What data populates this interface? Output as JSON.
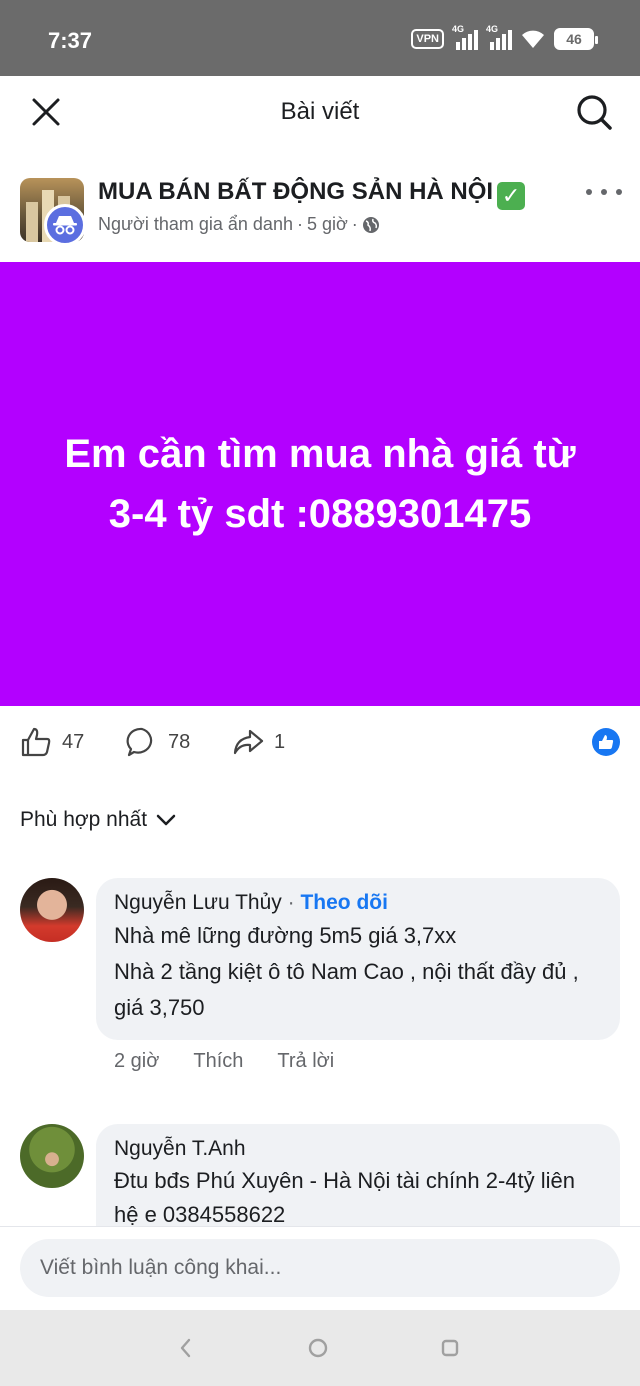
{
  "status_bar": {
    "time": "7:37",
    "vpn": "VPN",
    "network1": "4G",
    "network2": "4G",
    "battery": "46"
  },
  "header": {
    "title": "Bài viết",
    "close_icon": "close-icon",
    "search_icon": "search-icon"
  },
  "post": {
    "group_name": "MUA BÁN BẤT ĐỘNG SẢN HÀ NỘI",
    "author": "Người tham gia ẩn danh",
    "time": "5 giờ",
    "separator": "·",
    "body_text": "Em cần tìm mua nhà giá từ 3-4 tỷ sdt :0889301475",
    "body_bg": "#b300ff",
    "likes": "47",
    "comments": "78",
    "shares": "1"
  },
  "sort": {
    "label": "Phù hợp nhất"
  },
  "comments": [
    {
      "name": "Nguyễn Lưu Thủy",
      "dot": " · ",
      "follow": "Theo dõi",
      "lines": [
        "Nhà mê lững đường 5m5 giá 3,7xx",
        "Nhà 2 tầng kiệt ô tô Nam Cao , nội thất đầy đủ , giá 3,750"
      ],
      "time": "2 giờ",
      "like": "Thích",
      "reply": "Trả lời"
    },
    {
      "name": "Nguyễn T.Anh",
      "lines": [
        "Đtu bđs Phú Xuyên - Hà Nội tài chính 2-4tỷ liên hệ e 0384558622"
      ]
    }
  ],
  "composer": {
    "placeholder": "Viết bình luận công khai..."
  },
  "colors": {
    "accent": "#1877f2",
    "post_background": "#b300ff",
    "status_bar": "#6b6b6b"
  }
}
